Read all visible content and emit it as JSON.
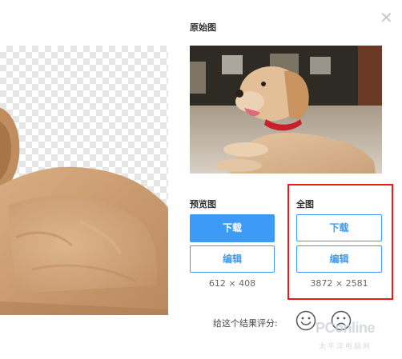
{
  "original": {
    "title": "原始图"
  },
  "preview": {
    "title": "预览图",
    "download_label": "下载",
    "edit_label": "编辑",
    "size": "612 × 408"
  },
  "full": {
    "title": "全图",
    "download_label": "下载",
    "edit_label": "编辑",
    "size": "3872 × 2581"
  },
  "rating": {
    "prompt": "给这个结果评分:"
  },
  "watermark": {
    "brand": "PConline",
    "sub": "太平洋电脑网"
  },
  "colors": {
    "accent": "#3d9bf6",
    "highlight": "#e51c1c"
  },
  "icons": [
    "close-icon",
    "smile-icon",
    "frown-icon"
  ]
}
